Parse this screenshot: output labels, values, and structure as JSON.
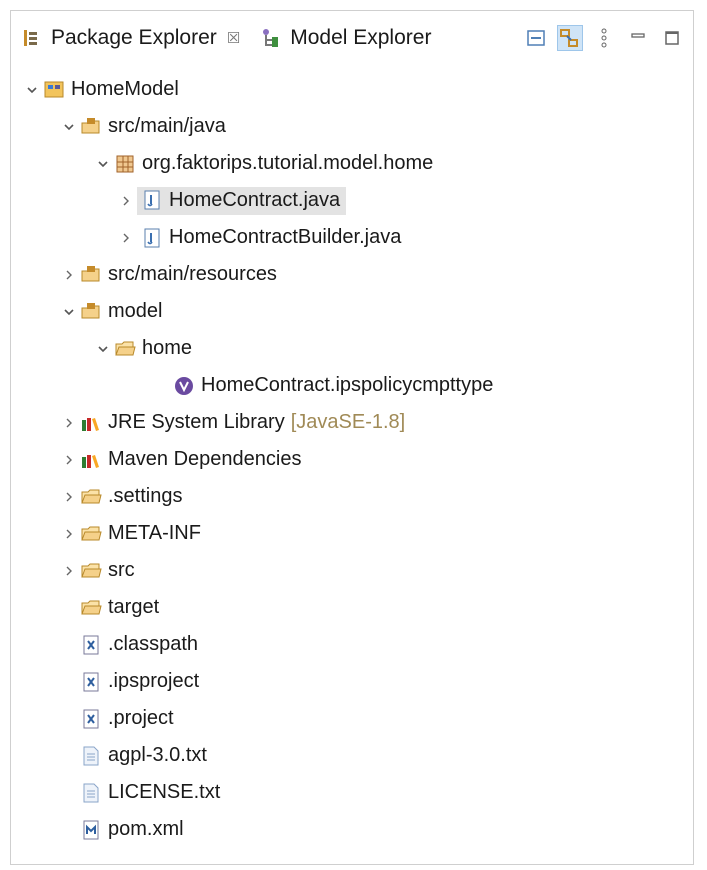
{
  "tabs": [
    {
      "label": "Package Explorer",
      "close": "☒",
      "icon": "package-explorer-icon",
      "active": true
    },
    {
      "label": "Model Explorer",
      "icon": "model-explorer-icon",
      "active": false
    }
  ],
  "toolbar": {
    "buttons": [
      "collapse-all-icon",
      "link-with-editor-icon",
      "view-menu-icon",
      "minimize-icon",
      "maximize-icon"
    ]
  },
  "tree": [
    {
      "label": "HomeModel",
      "expanded": true,
      "icon": "faktor-project-icon"
    },
    {
      "label": "src/main/java",
      "expanded": true,
      "icon": "source-folder-icon"
    },
    {
      "label": "org.faktorips.tutorial.model.home",
      "expanded": true,
      "icon": "package-icon"
    },
    {
      "label": "HomeContract.java",
      "expanded": false,
      "icon": "java-file-icon",
      "selected": true
    },
    {
      "label": "HomeContractBuilder.java",
      "expanded": false,
      "icon": "java-file-icon"
    },
    {
      "label": "src/main/resources",
      "expanded": false,
      "icon": "source-folder-icon"
    },
    {
      "label": "model",
      "expanded": true,
      "icon": "source-folder-icon"
    },
    {
      "label": "home",
      "expanded": true,
      "icon": "folder-icon"
    },
    {
      "label": "HomeContract.ipspolicycmpttype",
      "icon": "policy-cmpt-type-icon"
    },
    {
      "label": "JRE System Library",
      "decoration": "[JavaSE-1.8]",
      "expanded": false,
      "icon": "library-icon"
    },
    {
      "label": "Maven Dependencies",
      "expanded": false,
      "icon": "library-icon"
    },
    {
      "label": ".settings",
      "expanded": false,
      "icon": "folder-icon"
    },
    {
      "label": "META-INF",
      "expanded": false,
      "icon": "folder-icon"
    },
    {
      "label": "src",
      "expanded": false,
      "icon": "folder-icon"
    },
    {
      "label": "target",
      "icon": "folder-icon"
    },
    {
      "label": ".classpath",
      "icon": "xml-file-icon"
    },
    {
      "label": ".ipsproject",
      "icon": "xml-file-icon"
    },
    {
      "label": ".project",
      "icon": "xml-file-icon"
    },
    {
      "label": "agpl-3.0.txt",
      "icon": "text-file-icon"
    },
    {
      "label": "LICENSE.txt",
      "icon": "text-file-icon"
    },
    {
      "label": "pom.xml",
      "icon": "maven-pom-icon"
    }
  ]
}
